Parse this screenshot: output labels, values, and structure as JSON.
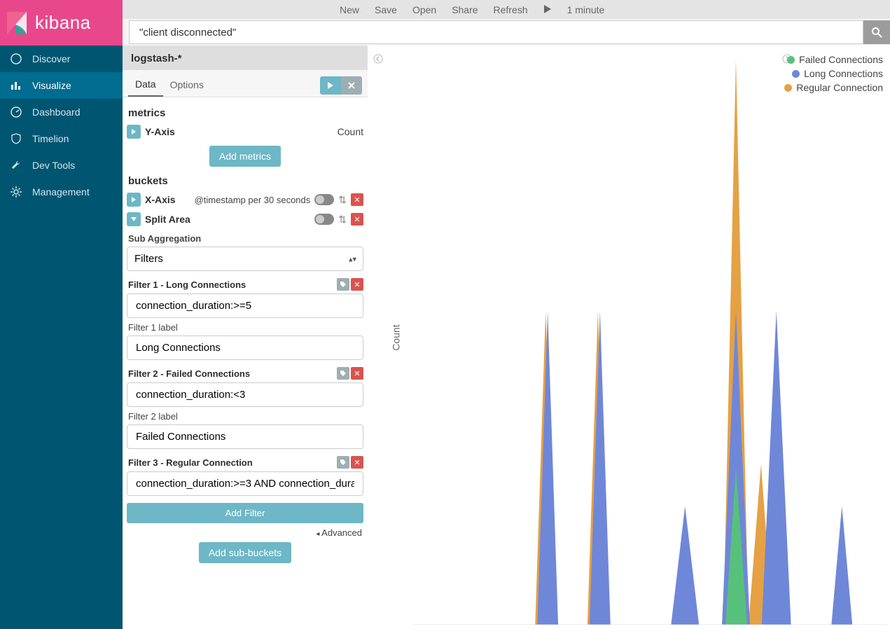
{
  "brand": "kibana",
  "topbar": {
    "new": "New",
    "save": "Save",
    "open": "Open",
    "share": "Share",
    "refresh": "Refresh",
    "interval": "1 minute"
  },
  "search": {
    "value": "\"client disconnected\""
  },
  "nav": {
    "discover": "Discover",
    "visualize": "Visualize",
    "dashboard": "Dashboard",
    "timelion": "Timelion",
    "devtools": "Dev Tools",
    "management": "Management"
  },
  "config": {
    "index_pattern": "logstash-*",
    "tabs": {
      "data": "Data",
      "options": "Options"
    },
    "metrics_title": "metrics",
    "yaxis_label": "Y-Axis",
    "yaxis_value": "Count",
    "add_metrics": "Add metrics",
    "buckets_title": "buckets",
    "xaxis_label": "X-Axis",
    "xaxis_value": "@timestamp per 30 seconds",
    "split_area": "Split Area",
    "sub_agg_label": "Sub Aggregation",
    "sub_agg_value": "Filters",
    "filters": [
      {
        "head": "Filter 1 - Long Connections",
        "query": "connection_duration:>=5",
        "label_caption": "Filter 1 label",
        "label_value": "Long Connections"
      },
      {
        "head": "Filter 2 - Failed Connections",
        "query": "connection_duration:<3",
        "label_caption": "Filter 2 label",
        "label_value": "Failed Connections"
      },
      {
        "head": "Filter 3 - Regular Connection",
        "query": "connection_duration:>=3 AND connection_dura",
        "label_caption": "",
        "label_value": ""
      }
    ],
    "add_filter": "Add Filter",
    "advanced": "Advanced",
    "add_sub_buckets": "Add sub-buckets"
  },
  "chart": {
    "ylabel": "Count",
    "legend": [
      {
        "label": "Failed Connections",
        "color": "#57c17b"
      },
      {
        "label": "Long Connections",
        "color": "#6f87d8"
      },
      {
        "label": "Regular Connection",
        "color": "#e5a144"
      }
    ]
  },
  "colors": {
    "green": "#57c17b",
    "blue": "#6f87d8",
    "orange": "#e5a144"
  },
  "chart_data": {
    "type": "area",
    "xlabel": "@timestamp per 30 seconds",
    "ylabel": "Count",
    "x_index": [
      0,
      1,
      2,
      3,
      4,
      5,
      6,
      7,
      8,
      9,
      10,
      11,
      12,
      13,
      14,
      15,
      16,
      17,
      18,
      19
    ],
    "series": [
      {
        "name": "Failed Connections",
        "color": "#57c17b",
        "values": [
          0,
          0,
          0,
          0,
          0,
          0,
          0,
          0,
          0,
          0,
          0,
          0,
          0,
          28,
          0,
          0,
          0,
          0,
          0,
          0
        ]
      },
      {
        "name": "Long Connections",
        "color": "#6f87d8",
        "values": [
          0,
          0,
          0,
          0,
          0,
          55,
          0,
          55,
          0,
          0,
          20,
          0,
          0,
          55,
          0,
          55,
          0,
          0,
          20,
          0
        ]
      },
      {
        "name": "Regular Connection",
        "color": "#e5a144",
        "values": [
          0,
          0,
          0,
          0,
          0,
          55,
          0,
          55,
          0,
          0,
          0,
          0,
          0,
          100,
          28,
          0,
          0,
          0,
          0,
          0
        ]
      }
    ],
    "note": "Values approximate on 0–100 relative scale (ticks not shown in screenshot)."
  }
}
